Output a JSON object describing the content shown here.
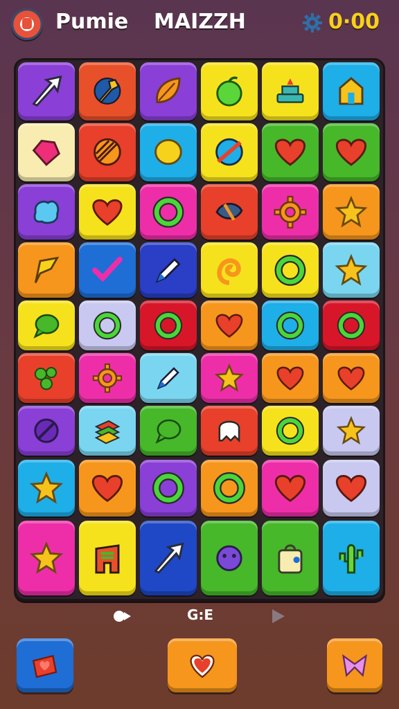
{
  "header": {
    "app_title": "Pumie",
    "game_title": "MAIZZH",
    "score": "0·00",
    "icons": [
      "logo-icon",
      "gear-icon"
    ]
  },
  "board": {
    "rows": 9,
    "cols": 6,
    "tiles": [
      [
        {
          "icon": "arrow-icon",
          "color": "#8a3fd6"
        },
        {
          "icon": "wrench-icon",
          "color": "#e8502a"
        },
        {
          "icon": "leaf-icon",
          "color": "#8a3fd6"
        },
        {
          "icon": "apple-icon",
          "color": "#f6e21c"
        },
        {
          "icon": "cake-icon",
          "color": "#f6e21c"
        },
        {
          "icon": "house-icon",
          "color": "#1eaee8"
        }
      ],
      [
        {
          "icon": "gem-icon",
          "color": "#f8ecb0"
        },
        {
          "icon": "ball-icon",
          "color": "#e8402a"
        },
        {
          "icon": "lemon-icon",
          "color": "#1eaee8"
        },
        {
          "icon": "planet-icon",
          "color": "#f6e21c"
        },
        {
          "icon": "heart-icon",
          "color": "#46b82a"
        },
        {
          "icon": "heart-icon",
          "color": "#46b82a"
        }
      ],
      [
        {
          "icon": "blob-icon",
          "color": "#8a3fd6"
        },
        {
          "icon": "heart-icon",
          "color": "#f6e21c"
        },
        {
          "icon": "ring-icon",
          "color": "#ee2ea8"
        },
        {
          "icon": "bird-icon",
          "color": "#e8402a"
        },
        {
          "icon": "gear-icon",
          "color": "#ee2ea8"
        },
        {
          "icon": "star-icon",
          "color": "#f6961c"
        }
      ],
      [
        {
          "icon": "flag-icon",
          "color": "#f6961c"
        },
        {
          "icon": "check-icon",
          "color": "#1e6ed6"
        },
        {
          "icon": "pen-icon",
          "color": "#2a3ec6"
        },
        {
          "icon": "swirl-icon",
          "color": "#f6e21c"
        },
        {
          "icon": "ring-icon",
          "color": "#f6e21c"
        },
        {
          "icon": "star-icon",
          "color": "#7ad6f0"
        }
      ],
      [
        {
          "icon": "bubble-icon",
          "color": "#f6e21c"
        },
        {
          "icon": "ring-icon",
          "color": "#c8c8f0"
        },
        {
          "icon": "ring-icon",
          "color": "#d8162a"
        },
        {
          "icon": "heart-icon",
          "color": "#f6961c"
        },
        {
          "icon": "ring-icon",
          "color": "#1eaee8"
        },
        {
          "icon": "ring-icon",
          "color": "#d8162a"
        }
      ],
      [
        {
          "icon": "dots-icon",
          "color": "#e8402a"
        },
        {
          "icon": "gear-icon",
          "color": "#ee2ea8"
        },
        {
          "icon": "pen-icon",
          "color": "#7ad6f0"
        },
        {
          "icon": "star-icon",
          "color": "#ee2ea8"
        },
        {
          "icon": "heart-icon",
          "color": "#f6961c"
        },
        {
          "icon": "heart-icon",
          "color": "#f6961c"
        }
      ],
      [
        {
          "icon": "no-icon",
          "color": "#8a3fd6"
        },
        {
          "icon": "stack-icon",
          "color": "#7ad6f0"
        },
        {
          "icon": "bubble-icon",
          "color": "#46b82a"
        },
        {
          "icon": "ghost-icon",
          "color": "#e8402a"
        },
        {
          "icon": "ring-icon",
          "color": "#f6e21c"
        },
        {
          "icon": "star-icon",
          "color": "#c8c8f0"
        }
      ],
      [
        {
          "icon": "star-icon",
          "color": "#1eaee8"
        },
        {
          "icon": "heart-icon",
          "color": "#f6961c"
        },
        {
          "icon": "ring-icon",
          "color": "#8a3fd6"
        },
        {
          "icon": "ring-icon",
          "color": "#f6961c"
        },
        {
          "icon": "heart-icon",
          "color": "#ee2ea8"
        },
        {
          "icon": "heart-icon",
          "color": "#c8c8f0"
        }
      ],
      [
        {
          "icon": "star-icon",
          "color": "#ee2ea8"
        },
        {
          "icon": "building-icon",
          "color": "#f6e21c"
        },
        {
          "icon": "arrow-icon",
          "color": "#1e48c6"
        },
        {
          "icon": "flower-icon",
          "color": "#46b82a"
        },
        {
          "icon": "bag-icon",
          "color": "#46b82a"
        },
        {
          "icon": "cactus-icon",
          "color": "#1eaee8"
        }
      ]
    ]
  },
  "controls": {
    "left_icon": "record-icon",
    "label": "G:E",
    "right_icon": "play-icon"
  },
  "buttons": [
    {
      "icon": "heart-book-icon",
      "color": "#1e6ed6"
    },
    {
      "icon": "heart-icon",
      "color": "#f6961c"
    },
    {
      "icon": "bow-icon",
      "color": "#f6961c"
    }
  ]
}
